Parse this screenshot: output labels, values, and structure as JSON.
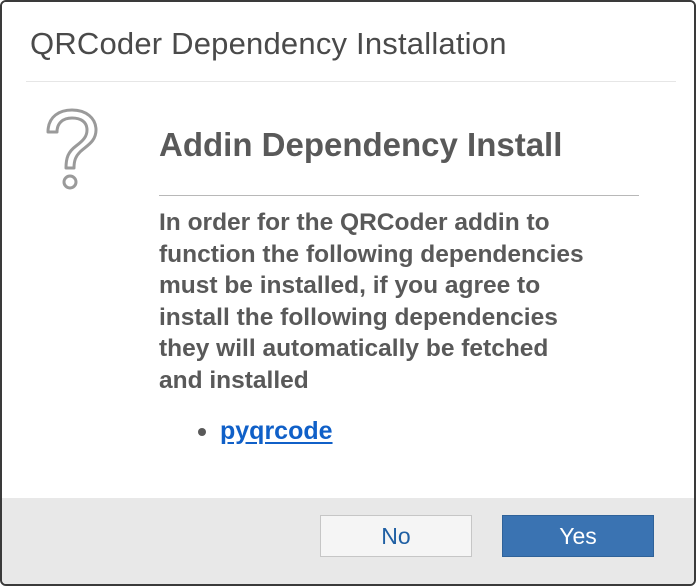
{
  "window": {
    "title": "QRCoder Dependency Installation"
  },
  "content": {
    "icon": "question-mark-icon",
    "heading": "Addin Dependency Install",
    "message_lines": [
      "In order for the QRCoder addin to",
      "function the following dependencies",
      "must be installed, if you agree to",
      "install the following dependencies",
      "they will automatically be fetched",
      "and installed"
    ],
    "dependencies": [
      {
        "name": "pyqrcode"
      }
    ]
  },
  "buttons": {
    "no_label": "No",
    "yes_label": "Yes"
  },
  "colors": {
    "link": "#1060c8",
    "primary_button": "#3a73b2",
    "text": "#595959",
    "footer": "#e8e8e8"
  }
}
